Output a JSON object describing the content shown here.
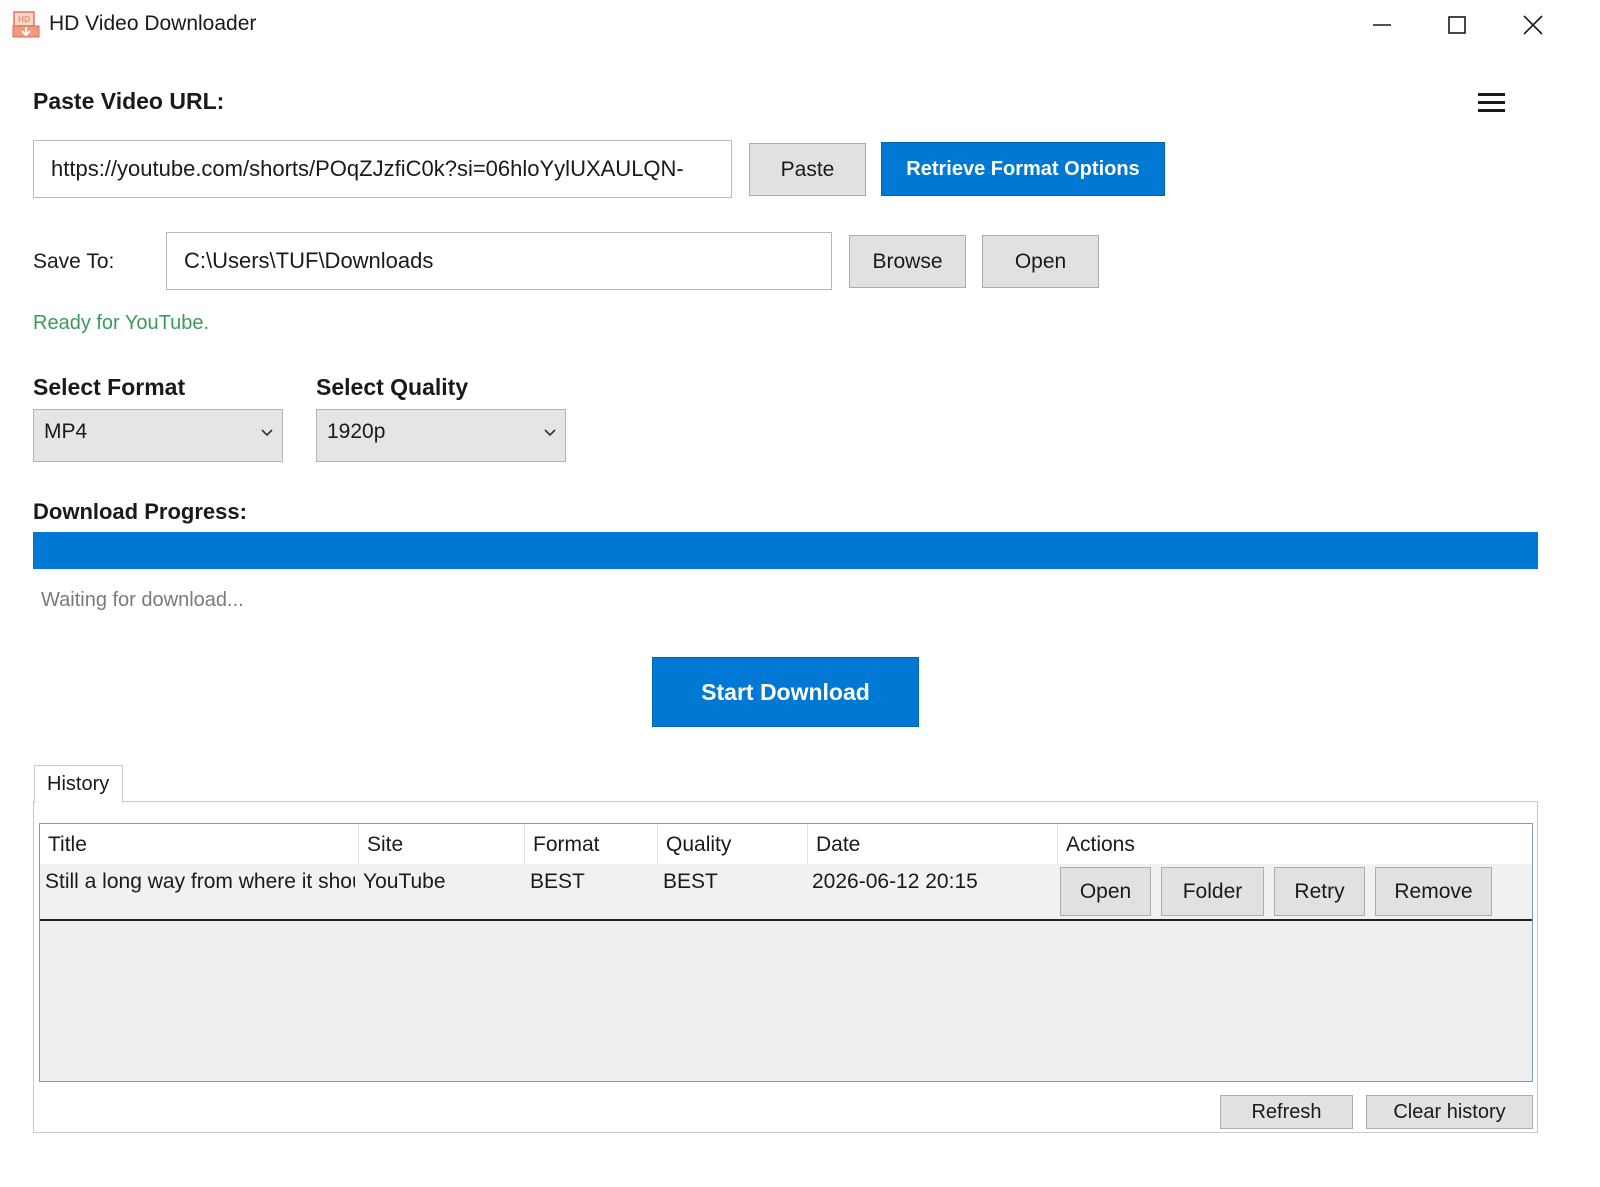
{
  "window": {
    "title": "HD Video Downloader",
    "app_icon": "download-app-icon",
    "controls": [
      "minimize-icon",
      "maximize-icon",
      "close-icon"
    ]
  },
  "menu_icon": "hamburger-menu-icon",
  "url_section": {
    "label": "Paste Video URL:",
    "url_value": "https://youtube.com/shorts/POqZJzfiC0k?si=06hloYylUXAULQN-",
    "paste_label": "Paste",
    "retrieve_label": "Retrieve Format Options"
  },
  "save_section": {
    "label": "Save To:",
    "path_value": "C:\\Users\\TUF\\Downloads",
    "browse_label": "Browse",
    "open_label": "Open"
  },
  "status_text": "Ready for YouTube.",
  "format": {
    "label": "Select Format",
    "selected": "MP4"
  },
  "quality": {
    "label": "Select Quality",
    "selected": "1920p"
  },
  "progress": {
    "label": "Download Progress:",
    "fraction": 1.0,
    "status": "Waiting for download..."
  },
  "start_download_label": "Start Download",
  "history": {
    "tab_label": "History",
    "columns": [
      "Title",
      "Site",
      "Format",
      "Quality",
      "Date",
      "Actions"
    ],
    "rows": [
      {
        "title": "Still a long way from where it shoul",
        "site": "YouTube",
        "format": "BEST",
        "quality": "BEST",
        "date": "2026-06-12 20:15",
        "actions": [
          "Open",
          "Folder",
          "Retry",
          "Remove"
        ]
      }
    ],
    "refresh_label": "Refresh",
    "clear_label": "Clear history"
  },
  "colors": {
    "accent": "#0078d4",
    "status_green": "#3a9a5c",
    "muted_text": "#7a7a7a"
  }
}
